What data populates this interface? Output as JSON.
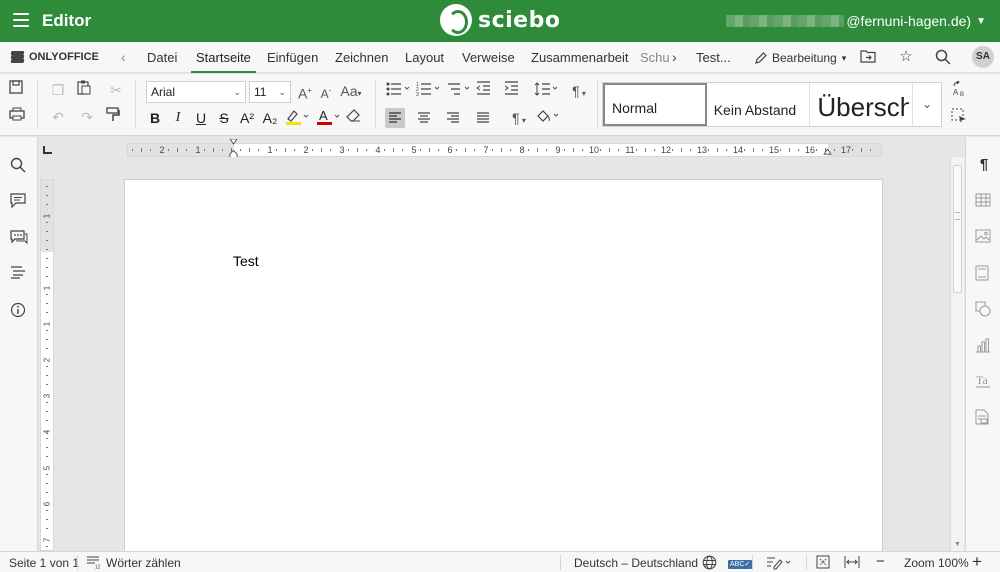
{
  "topbar": {
    "title": "Editor",
    "logo_text": "sciebo",
    "user_email_suffix": "@fernuni-hagen.de)"
  },
  "tabs": {
    "brand": "ONLYOFFICE",
    "items": [
      "Datei",
      "Startseite",
      "Einfügen",
      "Zeichnen",
      "Layout",
      "Verweise",
      "Zusammenarbeit",
      "Schu"
    ],
    "active": "Startseite",
    "doc_title": "Test...",
    "mode_label": "Bearbeitung",
    "avatar_initials": "SA"
  },
  "toolbar": {
    "font_name": "Arial",
    "font_size": "11",
    "text_case_label": "Aa",
    "bold": "B",
    "italic": "I",
    "underline": "U",
    "strike": "S",
    "superscript": "A²",
    "subscript": "A₂",
    "font_color_letter": "A",
    "pilcrow": "¶",
    "styles": [
      "Normal",
      "Kein Abstand",
      "Überschrift"
    ],
    "highlight_color": "#f5e400",
    "font_color": "#d20000"
  },
  "ruler": {
    "h_numbers": [
      "2",
      "1",
      "1",
      "2",
      "3",
      "4",
      "5",
      "6",
      "7",
      "8",
      "9",
      "10",
      "11",
      "12",
      "13",
      "14",
      "15",
      "16",
      "17"
    ],
    "v_numbers": [
      "1",
      "1",
      "1",
      "2",
      "3",
      "4",
      "5",
      "6",
      "7",
      "8"
    ]
  },
  "document": {
    "body_text": "Test"
  },
  "status": {
    "page": "Seite 1 von 1",
    "word_count": "Wörter zählen",
    "language": "Deutsch – Deutschland",
    "zoom": "Zoom 100%"
  },
  "colors": {
    "brand_green": "#2e8b39"
  }
}
